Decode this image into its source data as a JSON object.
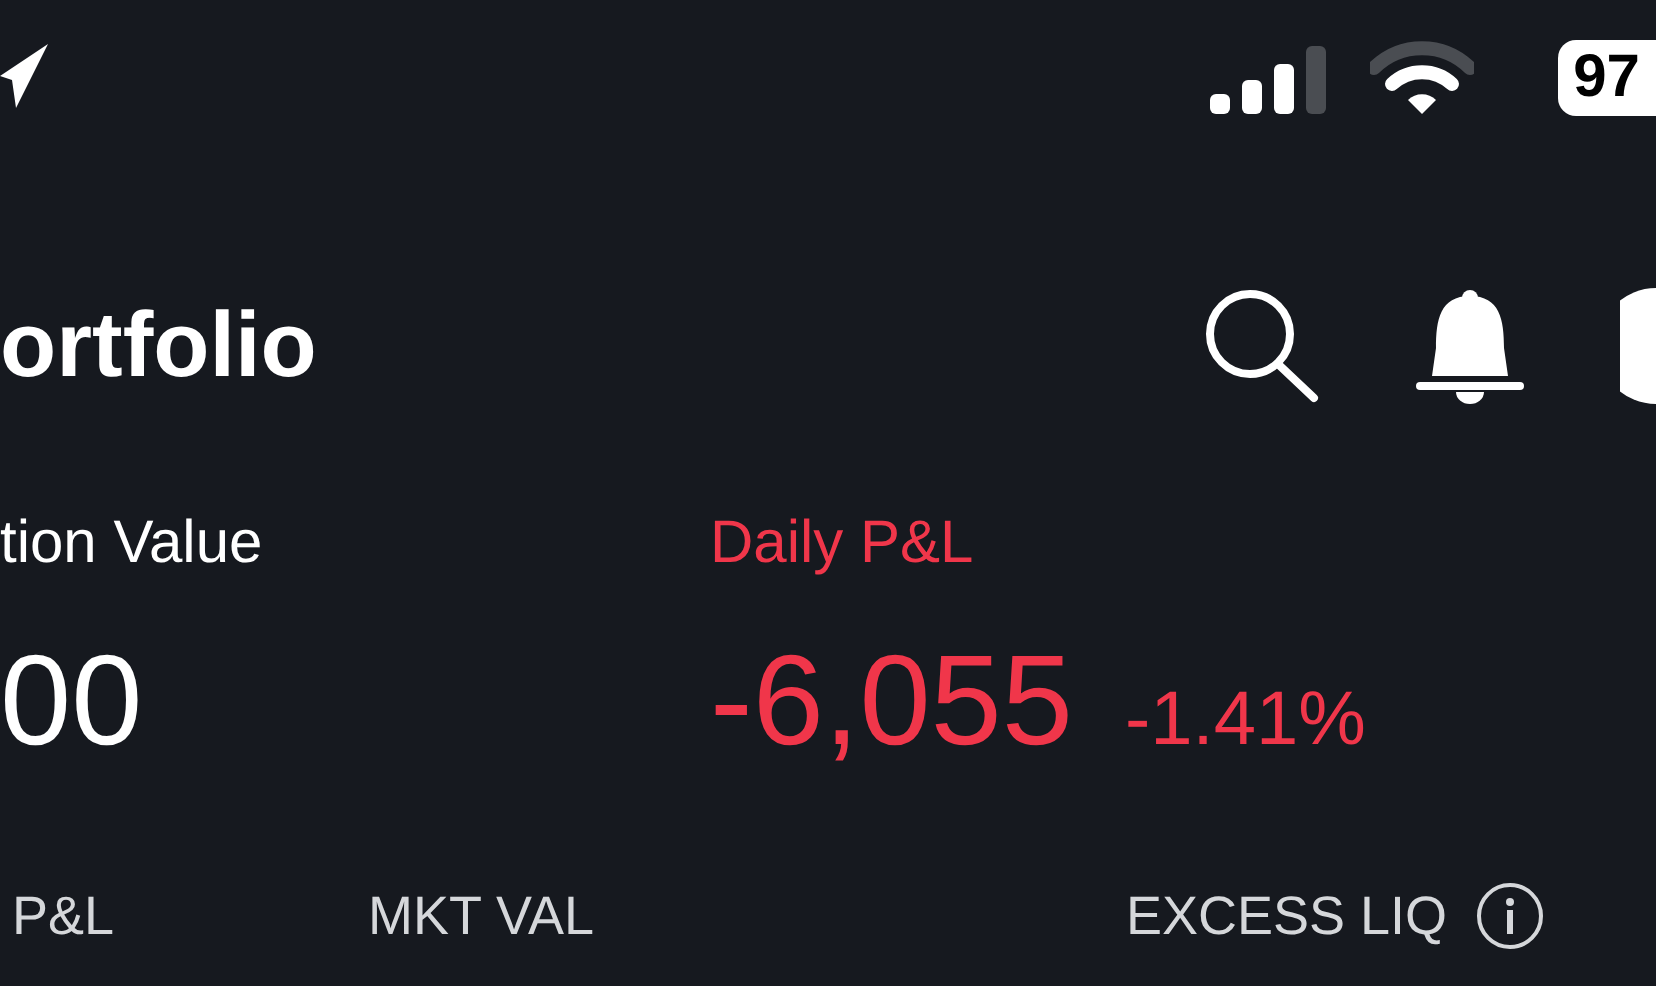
{
  "status_bar": {
    "battery": "97"
  },
  "header": {
    "title": "ortfolio"
  },
  "summary": [
    {
      "label": "tion Value",
      "value": "00",
      "color": "#ffffff"
    },
    {
      "label": "Daily P&L",
      "value": "-6,055",
      "change": "-1.41%",
      "color": "#f0364a"
    }
  ],
  "columns": [
    {
      "label": "P&L",
      "info": false
    },
    {
      "label": "MKT VAL",
      "info": false
    },
    {
      "label": "EXCESS LIQ",
      "info": true
    }
  ]
}
